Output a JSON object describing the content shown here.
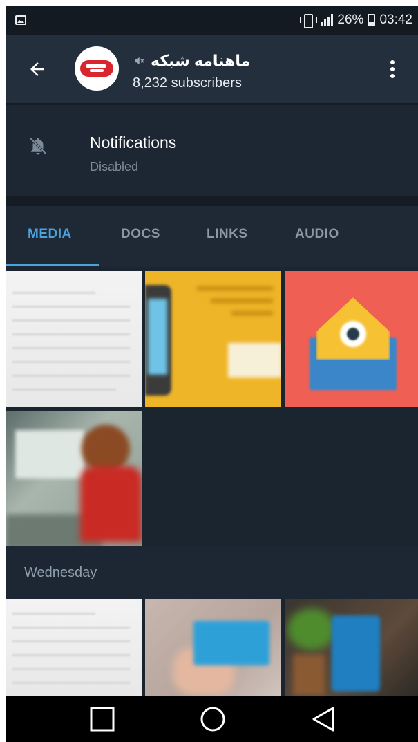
{
  "status_bar": {
    "battery_percent": "26%",
    "time": "03:42",
    "left_icon": "image-icon",
    "icons": [
      "vibrate-icon",
      "signal-icon",
      "battery-icon"
    ]
  },
  "header": {
    "back_icon": "arrow-left-icon",
    "channel_name": "ماهنامه شبکه",
    "muted_icon": "muted-icon",
    "subscribers": "8,232 subscribers",
    "menu_icon": "more-vert-icon"
  },
  "notifications": {
    "icon": "bell-off-icon",
    "label": "Notifications",
    "value": "Disabled"
  },
  "tabs": [
    {
      "label": "MEDIA",
      "active": true
    },
    {
      "label": "DOCS",
      "active": false
    },
    {
      "label": "LINKS",
      "active": false
    },
    {
      "label": "AUDIO",
      "active": false
    }
  ],
  "sections": [
    {
      "label": "",
      "thumbnails": 4
    },
    {
      "label": "Wednesday",
      "thumbnails": 3
    }
  ],
  "colors": {
    "accent": "#4aa3df",
    "background": "#1d2733",
    "header": "#242f3d",
    "status_bar": "#131a21"
  },
  "nav_bar": {
    "buttons": [
      "recents-square-icon",
      "home-circle-icon",
      "back-triangle-icon"
    ]
  }
}
